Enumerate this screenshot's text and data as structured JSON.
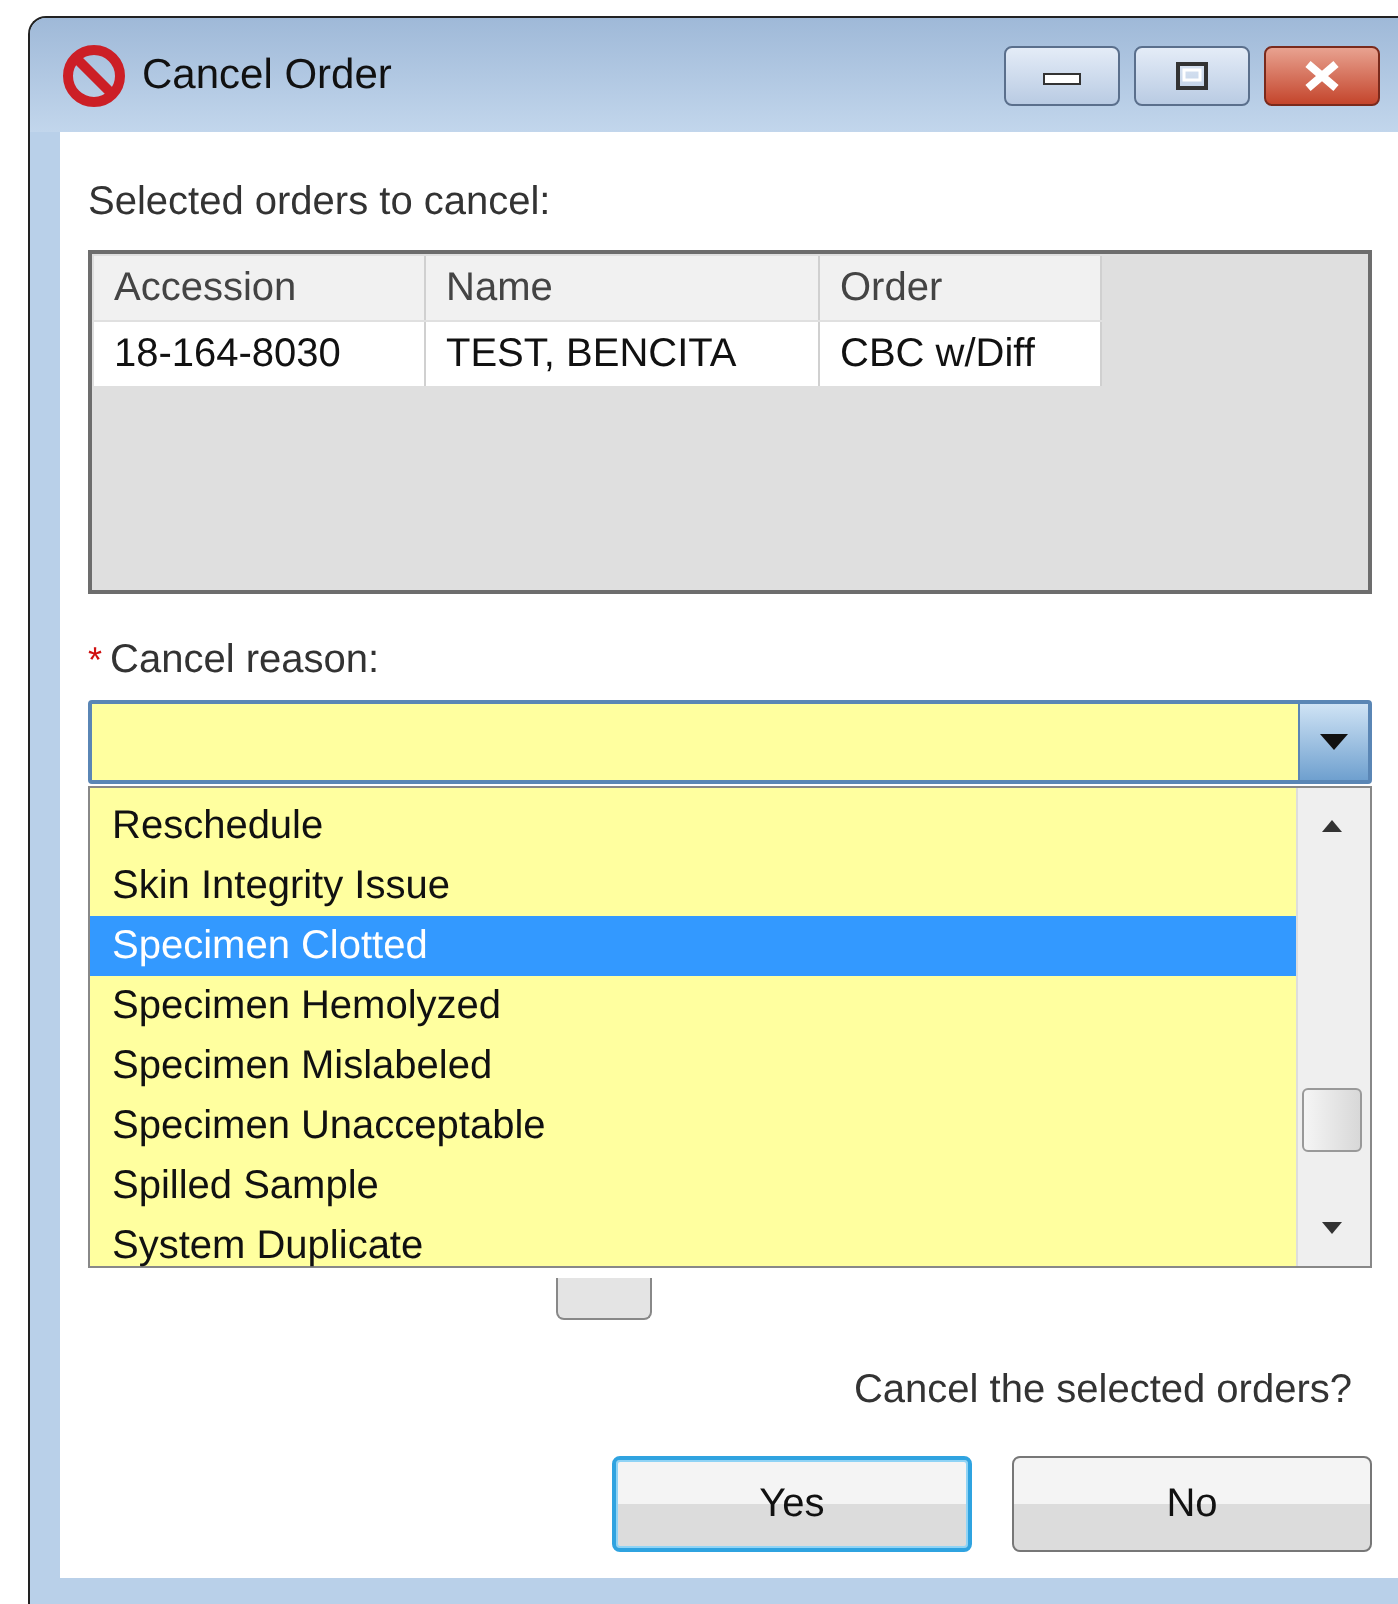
{
  "window": {
    "title": "Cancel Order"
  },
  "orders_label": "Selected orders to cancel:",
  "orders_table": {
    "columns": [
      "Accession",
      "Name",
      "Order"
    ],
    "rows": [
      [
        "18-164-8030",
        "TEST, BENCITA",
        "CBC w/Diff"
      ]
    ]
  },
  "reason": {
    "required_mark": "*",
    "label": "Cancel reason:",
    "expanded": true,
    "options": [
      {
        "label": "Reschedule",
        "selected": false
      },
      {
        "label": "Skin Integrity Issue",
        "selected": false
      },
      {
        "label": "Specimen Clotted",
        "selected": true
      },
      {
        "label": "Specimen Hemolyzed",
        "selected": false
      },
      {
        "label": "Specimen Mislabeled",
        "selected": false
      },
      {
        "label": "Specimen Unacceptable",
        "selected": false
      },
      {
        "label": "Spilled Sample",
        "selected": false
      },
      {
        "label": "System Duplicate",
        "selected": false
      }
    ]
  },
  "confirm_text": "Cancel the selected orders?",
  "buttons": [
    {
      "label": "Yes",
      "default": true
    },
    {
      "label": "No",
      "default": false
    }
  ]
}
